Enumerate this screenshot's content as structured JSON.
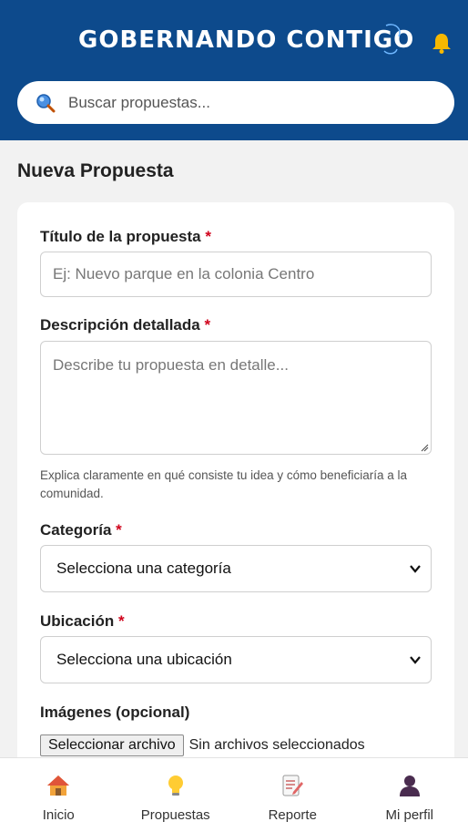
{
  "header": {
    "logo_text": "GOBERNANDO CONTIGO",
    "brand_color": "#0d4a8c"
  },
  "search": {
    "placeholder": "Buscar propuestas..."
  },
  "page": {
    "title": "Nueva Propuesta"
  },
  "form": {
    "title_label": "Título de la propuesta",
    "title_placeholder": "Ej: Nuevo parque en la colonia Centro",
    "description_label": "Descripción detallada",
    "description_placeholder": "Describe tu propuesta en detalle...",
    "description_help": "Explica claramente en qué consiste tu idea y cómo beneficiaría a la comunidad.",
    "category_label": "Categoría",
    "category_selected": "Selecciona una categoría",
    "location_label": "Ubicación",
    "location_selected": "Selecciona una ubicación",
    "images_label": "Imágenes (opcional)",
    "file_button": "Seleccionar archivo",
    "file_status": "Sin archivos seleccionados",
    "required_mark": "*"
  },
  "nav": {
    "items": [
      {
        "label": "Inicio",
        "icon": "home-icon"
      },
      {
        "label": "Propuestas",
        "icon": "lightbulb-icon"
      },
      {
        "label": "Reporte",
        "icon": "report-icon"
      },
      {
        "label": "Mi perfil",
        "icon": "user-icon"
      }
    ]
  }
}
